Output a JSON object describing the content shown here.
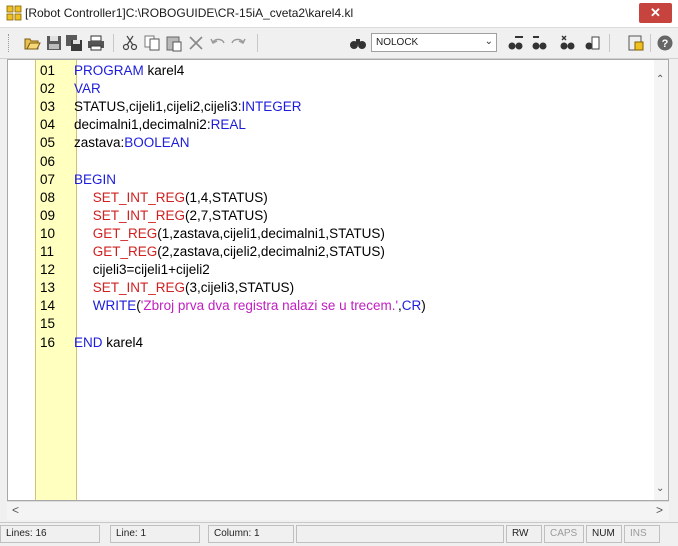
{
  "window": {
    "title": "[Robot Controller1]C:\\ROBOGUIDE\\CR-15iA_cveta2\\karel4.kl",
    "close_label": "✕"
  },
  "toolbar": {
    "buttons": [
      "open-icon",
      "save-icon",
      "save-all-icon",
      "print-icon",
      "cut-icon",
      "copy-icon",
      "paste-icon",
      "delete-icon",
      "undo-icon",
      "redo-icon",
      "find-icon",
      "tool-a-icon",
      "tool-b-icon",
      "tool-c-icon",
      "tool-d-icon",
      "translate-icon",
      "help-icon"
    ],
    "lock_combo": {
      "value": "NOLOCK"
    }
  },
  "editor": {
    "lines": [
      {
        "num": "01",
        "tokens": [
          [
            "kw",
            "PROGRAM"
          ],
          [
            "code",
            " karel4"
          ]
        ]
      },
      {
        "num": "02",
        "tokens": [
          [
            "kw",
            "VAR"
          ]
        ]
      },
      {
        "num": "03",
        "tokens": [
          [
            "code",
            "STATUS,cijeli1,cijeli2,cijeli3:"
          ],
          [
            "kw",
            "INTEGER"
          ]
        ]
      },
      {
        "num": "04",
        "tokens": [
          [
            "code",
            "decimalni1,decimalni2:"
          ],
          [
            "kw",
            "REAL"
          ]
        ]
      },
      {
        "num": "05",
        "tokens": [
          [
            "code",
            "zastava:"
          ],
          [
            "kw",
            "BOOLEAN"
          ]
        ]
      },
      {
        "num": "06",
        "tokens": []
      },
      {
        "num": "07",
        "tokens": [
          [
            "kw",
            "BEGIN"
          ]
        ]
      },
      {
        "num": "08",
        "tokens": [
          [
            "code",
            "     "
          ],
          [
            "fn",
            "SET_INT_REG"
          ],
          [
            "code",
            "(1,4,STATUS)"
          ]
        ]
      },
      {
        "num": "09",
        "tokens": [
          [
            "code",
            "     "
          ],
          [
            "fn",
            "SET_INT_REG"
          ],
          [
            "code",
            "(2,7,STATUS)"
          ]
        ]
      },
      {
        "num": "10",
        "tokens": [
          [
            "code",
            "     "
          ],
          [
            "fn",
            "GET_REG"
          ],
          [
            "code",
            "(1,zastava,cijeli1,decimalni1,STATUS)"
          ]
        ]
      },
      {
        "num": "11",
        "tokens": [
          [
            "code",
            "     "
          ],
          [
            "fn",
            "GET_REG"
          ],
          [
            "code",
            "(2,zastava,cijeli2,decimalni2,STATUS)"
          ]
        ]
      },
      {
        "num": "12",
        "tokens": [
          [
            "code",
            "     cijeli3=cijeli1+cijeli2"
          ]
        ]
      },
      {
        "num": "13",
        "tokens": [
          [
            "code",
            "     "
          ],
          [
            "fn",
            "SET_INT_REG"
          ],
          [
            "code",
            "(3,cijeli3,STATUS)"
          ]
        ]
      },
      {
        "num": "14",
        "tokens": [
          [
            "code",
            "     "
          ],
          [
            "kw",
            "WRITE"
          ],
          [
            "code",
            "("
          ],
          [
            "str",
            "'Zbroj prva dva registra nalazi se u trecem.'"
          ],
          [
            "code",
            ","
          ],
          [
            "kw",
            "CR"
          ],
          [
            "code",
            ")"
          ]
        ]
      },
      {
        "num": "15",
        "tokens": []
      },
      {
        "num": "16",
        "tokens": [
          [
            "kw",
            "END"
          ],
          [
            "code",
            " karel4"
          ]
        ]
      }
    ]
  },
  "statusbar": {
    "lines": "Lines: 16",
    "line": "Line: 1",
    "column": "Column: 1",
    "rw": "RW",
    "caps": "CAPS",
    "num": "NUM",
    "ins": "INS"
  }
}
